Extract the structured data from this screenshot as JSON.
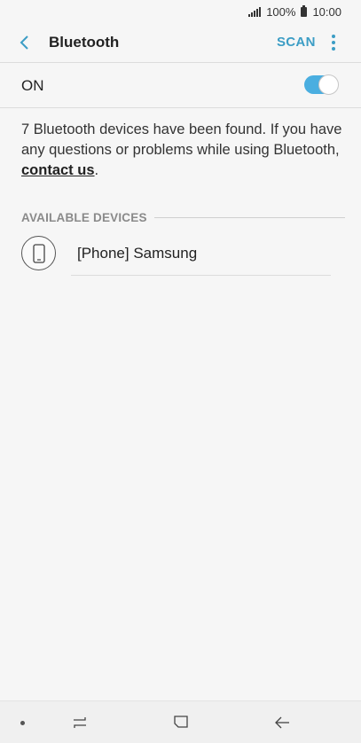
{
  "status_bar": {
    "battery": "100%",
    "time": "10:00",
    "icons": [
      "signal-icon",
      "battery-icon"
    ]
  },
  "app_bar": {
    "title": "Bluetooth",
    "scan_label": "SCAN",
    "icons": [
      "back-arrow-icon",
      "more-vertical-icon"
    ]
  },
  "toggle": {
    "label": "ON",
    "state": "on",
    "accent_color": "#4aaee0"
  },
  "info": {
    "text": "7 Bluetooth devices have been found. If you have any questions or problems while using Bluetooth, ",
    "link": "contact us",
    "suffix": "."
  },
  "available_devices": {
    "header": "AVAILABLE DEVICES",
    "items": [
      {
        "name": "[Phone] Samsung",
        "icon": "phone-icon"
      }
    ]
  },
  "nav_bar": {
    "icons": [
      "nav-dot-icon",
      "recents-icon",
      "home-icon",
      "back-icon"
    ]
  }
}
